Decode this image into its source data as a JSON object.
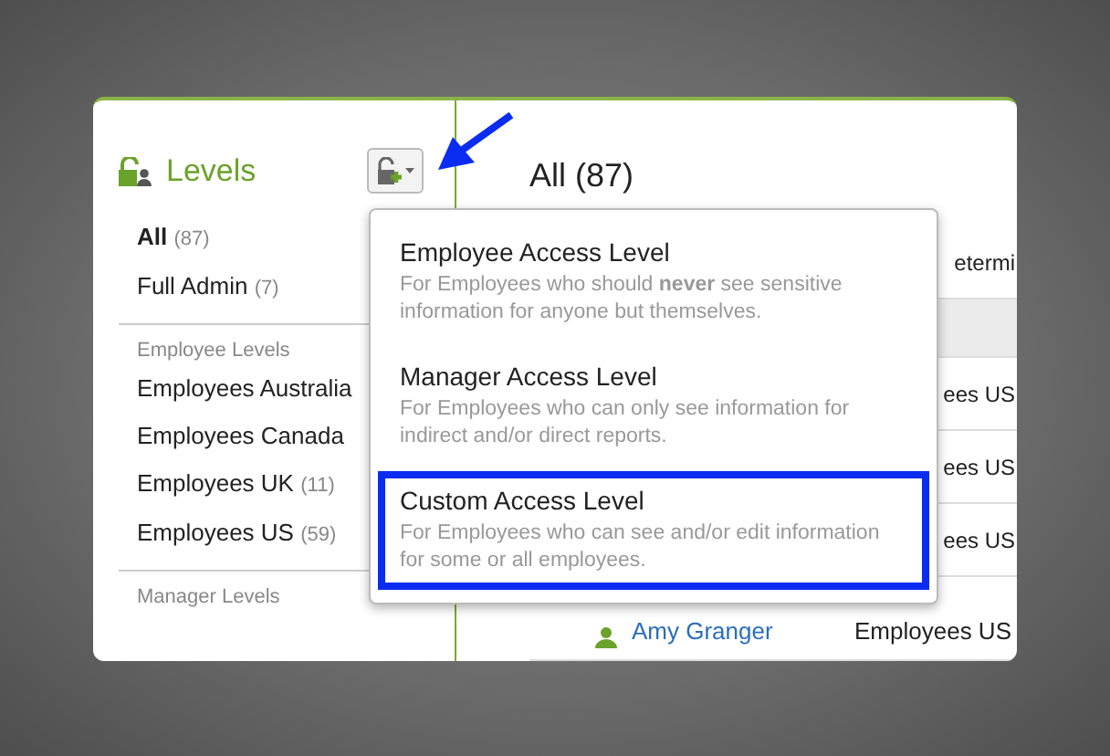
{
  "sidebar": {
    "title": "Levels",
    "sections": [
      {
        "items": [
          {
            "label": "All",
            "count": "(87)",
            "selected": true
          },
          {
            "label": "Full Admin",
            "count": "(7)",
            "selected": false
          }
        ]
      },
      {
        "heading": "Employee Levels",
        "items": [
          {
            "label": "Employees Australia",
            "selected": false
          },
          {
            "label": "Employees Canada",
            "selected": false
          },
          {
            "label": "Employees UK",
            "count": "(11)",
            "selected": false
          },
          {
            "label": "Employees US",
            "count": "(59)",
            "selected": false
          }
        ]
      },
      {
        "heading": "Manager Levels"
      }
    ]
  },
  "main": {
    "heading": "All (87)",
    "rows": [
      {
        "kind": "plain",
        "cell": "etermi"
      },
      {
        "kind": "header"
      },
      {
        "kind": "plain",
        "cell": "ees US"
      },
      {
        "kind": "plain",
        "cell": "ees US"
      },
      {
        "kind": "plain",
        "cell": "ees US"
      },
      {
        "kind": "employee",
        "name": "Amy Granger",
        "cell": "Employees US"
      }
    ]
  },
  "menu": {
    "items": [
      {
        "title": "Employee Access Level",
        "description": "For Employees who should **never** see sensitive information for anyone but themselves.",
        "selected": false
      },
      {
        "title": "Manager Access Level",
        "description": "For Employees who can only see information for indirect and/or direct reports.",
        "selected": false
      },
      {
        "title": "Custom Access Level",
        "description": "For Employees who can see and/or edit information for some or all employees.",
        "selected": true
      }
    ]
  }
}
